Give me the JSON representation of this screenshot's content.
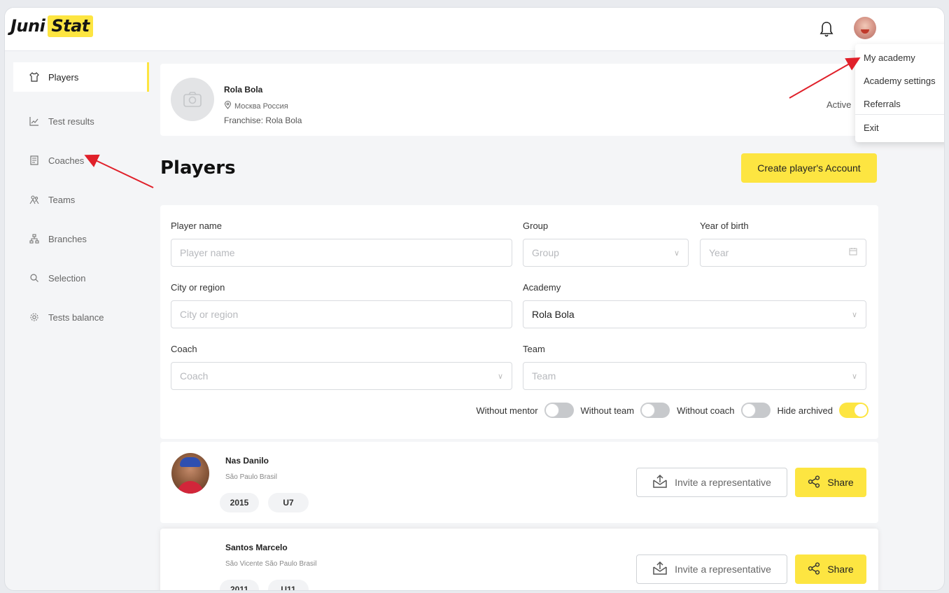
{
  "app": {
    "logo_part1": "Juni",
    "logo_part2": "Stat"
  },
  "header": {
    "bell_icon": "bell-icon",
    "avatar_icon": "user-avatar"
  },
  "dropdown": {
    "items": [
      "My academy",
      "Academy settings",
      "Referrals",
      "Exit"
    ]
  },
  "sidebar": {
    "items": [
      {
        "label": "Players",
        "icon": "shirt-icon",
        "active": true
      },
      {
        "label": "Test results",
        "icon": "chart-icon"
      },
      {
        "label": "Coaches",
        "icon": "clipboard-icon"
      },
      {
        "label": "Teams",
        "icon": "team-icon"
      },
      {
        "label": "Branches",
        "icon": "branches-icon"
      },
      {
        "label": "Selection",
        "icon": "search-icon"
      },
      {
        "label": "Tests balance",
        "icon": "gear-icon"
      }
    ]
  },
  "profile": {
    "name": "Rola Bola",
    "location": "Москва Россия",
    "franchise": "Franchise: Rola Bola",
    "status": "Active"
  },
  "page": {
    "title": "Players",
    "create_button": "Create player's Account"
  },
  "filters": {
    "player_name": {
      "label": "Player name",
      "placeholder": "Player name"
    },
    "group": {
      "label": "Group",
      "placeholder": "Group"
    },
    "year_of_birth": {
      "label": "Year of birth",
      "placeholder": "Year"
    },
    "city": {
      "label": "City or region",
      "placeholder": "City or region"
    },
    "academy": {
      "label": "Academy",
      "value": "Rola Bola"
    },
    "coach": {
      "label": "Coach",
      "placeholder": "Coach"
    },
    "team": {
      "label": "Team",
      "placeholder": "Team"
    }
  },
  "toggles": [
    {
      "label": "Without mentor",
      "on": false
    },
    {
      "label": "Without team",
      "on": false
    },
    {
      "label": "Without coach",
      "on": false
    },
    {
      "label": "Hide archived",
      "on": true
    }
  ],
  "players": [
    {
      "name": "Nas Danilo",
      "city": "São Paulo Brasil",
      "year": "2015",
      "group": "U7",
      "invite_label": "Invite a representative",
      "share_label": "Share"
    },
    {
      "name": "Santos Marcelo",
      "city": "São Vicente São Paulo Brasil",
      "year": "2011",
      "group": "U11",
      "invite_label": "Invite a representative",
      "share_label": "Share"
    }
  ],
  "colors": {
    "accent": "#fde541",
    "arrow": "#e0202a"
  }
}
